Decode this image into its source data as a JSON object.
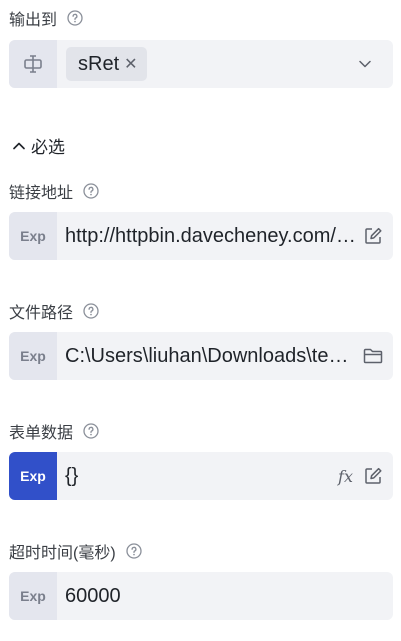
{
  "output": {
    "label": "输出到",
    "tag": "sRet",
    "icon": "variable-icon"
  },
  "section": {
    "title": "必选",
    "expanded": true
  },
  "fields": [
    {
      "label": "链接地址",
      "prefix": "Exp",
      "value": "http://httpbin.davecheney.com/post",
      "suffixes": [
        "edit-icon"
      ]
    },
    {
      "label": "文件路径",
      "prefix": "Exp",
      "value": "C:\\Users\\liuhan\\Downloads\\test.txt",
      "suffixes": [
        "folder-icon"
      ]
    },
    {
      "label": "表单数据",
      "prefix": "Exp",
      "value": "{}",
      "suffixes": [
        "fx-icon",
        "edit-icon"
      ],
      "prefix_active": true
    },
    {
      "label": "超时时间(毫秒)",
      "prefix": "Exp",
      "value": "60000",
      "suffixes": []
    }
  ],
  "colors": {
    "accent": "#3150c9",
    "field_bg": "#f2f3f6",
    "prefix_bg": "#e4e6ee"
  }
}
